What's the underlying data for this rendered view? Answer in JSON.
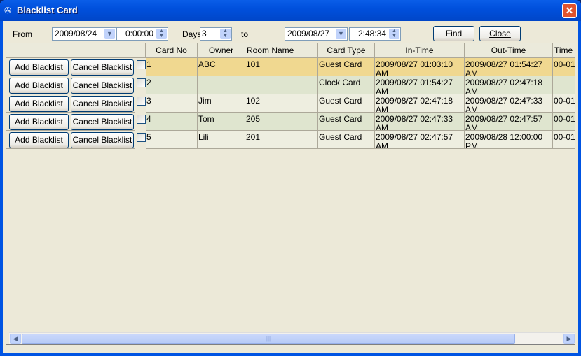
{
  "window": {
    "title": "Blacklist Card",
    "icon": "app-icon",
    "close_glyph": "✕"
  },
  "filters": {
    "from_label": "From",
    "from_date": "2009/08/24",
    "from_time": "0:00:00",
    "days_label": "Days",
    "days_value": "3",
    "to_label": "to",
    "to_date": "2009/08/27",
    "to_time": "2:48:34"
  },
  "buttons": {
    "find": "Find",
    "close": "Close"
  },
  "table": {
    "columns": [
      "Card No",
      "Owner",
      "Room Name",
      "Card Type",
      "In-Time",
      "Out-Time",
      "Time"
    ],
    "add_label": "Add Blacklist",
    "cancel_label": "Cancel Blacklist",
    "rows": [
      {
        "card_no": "1",
        "owner": "ABC",
        "room": "101",
        "type": "Guest Card",
        "in": "2009/08/27 01:03:10 AM",
        "out": "2009/08/27 01:54:27 AM",
        "time": "00-01",
        "selected": true
      },
      {
        "card_no": "2",
        "owner": "",
        "room": "",
        "type": "Clock Card",
        "in": "2009/08/27 01:54:27 AM",
        "out": "2009/08/27 02:47:18 AM",
        "time": ""
      },
      {
        "card_no": "3",
        "owner": "Jim",
        "room": "102",
        "type": "Guest Card",
        "in": "2009/08/27 02:47:18 AM",
        "out": "2009/08/27 02:47:33 AM",
        "time": "00-01"
      },
      {
        "card_no": "4",
        "owner": "Tom",
        "room": "205",
        "type": "Guest Card",
        "in": "2009/08/27 02:47:33 AM",
        "out": "2009/08/27 02:47:57 AM",
        "time": "00-01"
      },
      {
        "card_no": "5",
        "owner": "Lili",
        "room": "201",
        "type": "Guest Card",
        "in": "2009/08/27 02:47:57 AM",
        "out": "2009/08/28 12:00:00 PM",
        "time": "00-01"
      }
    ]
  },
  "colors": {
    "selected_row": "#f0d890",
    "alt_row": "#dfe5cf",
    "row": "#eeeee0",
    "title_bar": "#0054e3"
  }
}
